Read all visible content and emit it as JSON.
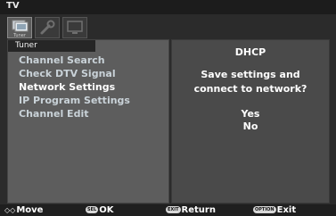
{
  "window": {
    "title": "TV"
  },
  "tabs": [
    {
      "icon": "tuner-icon",
      "caption": "Tuner",
      "active": true
    },
    {
      "icon": "tools-icon",
      "caption": "",
      "active": false
    },
    {
      "icon": "screen-icon",
      "caption": "",
      "active": false
    }
  ],
  "section": {
    "label": "Tuner"
  },
  "menu": {
    "items": [
      {
        "label": "Channel Search"
      },
      {
        "label": "Check DTV Signal"
      },
      {
        "label": "Network Settings",
        "selected": true
      },
      {
        "label": "IP Program Settings"
      },
      {
        "label": "Channel Edit"
      }
    ]
  },
  "dialog": {
    "title": "DHCP",
    "message_line1": "Save settings and",
    "message_line2": "connect to network?",
    "option_yes": "Yes",
    "option_no": "No"
  },
  "footer": {
    "move": {
      "key": "◇◇",
      "label": "Move"
    },
    "ok": {
      "key": "SEL",
      "label": "OK"
    },
    "return": {
      "key": "EXIT",
      "label": "Return"
    },
    "exit": {
      "key": "OPTION",
      "label": "Exit"
    }
  }
}
